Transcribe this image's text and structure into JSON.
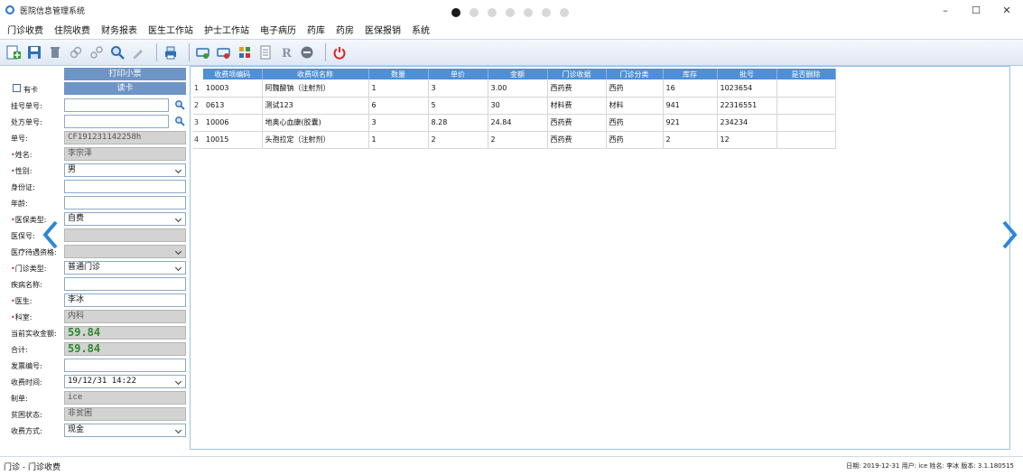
{
  "window": {
    "title": "医院信息管理系统",
    "controls": {
      "minimize": "–",
      "maximize": "☐",
      "close": "✕"
    }
  },
  "menu": [
    "门诊收费",
    "住院收费",
    "财务报表",
    "医生工作站",
    "护士工作站",
    "电子病历",
    "药库",
    "药房",
    "医保报销",
    "系统"
  ],
  "toolbar": {
    "icons": [
      "add-icon",
      "save-icon",
      "delete-icon",
      "link-icon",
      "unlink-icon",
      "search-icon",
      "edit-icon",
      "print-icon",
      "card-in-icon",
      "card-out-icon",
      "grid-icon",
      "document-icon",
      "prescription-icon",
      "stop-icon",
      "power-icon"
    ]
  },
  "left_panel": {
    "print_receipt": "打印小票",
    "has_card": "有卡",
    "read_card": "读卡",
    "fields": {
      "register_no": {
        "label": "挂号单号:",
        "value": ""
      },
      "prescription_no": {
        "label": "处方单号:",
        "value": ""
      },
      "bill_no": {
        "label": "单号:",
        "value": "CF191231142258h"
      },
      "name": {
        "label": "姓名:",
        "value": "李宗泽"
      },
      "gender": {
        "label": "性别:",
        "value": "男"
      },
      "id_card": {
        "label": "身份证:",
        "value": ""
      },
      "age": {
        "label": "年龄:",
        "value": ""
      },
      "insurance_type": {
        "label": "医保类型:",
        "value": "自费"
      },
      "insurance_no": {
        "label": "医保号:",
        "value": ""
      },
      "special_treatment": {
        "label": "医疗待遇资格:",
        "value": ""
      },
      "clinic_type": {
        "label": "门诊类型:",
        "value": "普通门诊"
      },
      "disease_name": {
        "label": "疾病名称:",
        "value": ""
      },
      "doctor": {
        "label": "医生:",
        "value": "李冰"
      },
      "department": {
        "label": "科室:",
        "value": "内科"
      },
      "current_paid": {
        "label": "当前实收金额:",
        "value": "59.84"
      },
      "total": {
        "label": "合计:",
        "value": "59.84"
      },
      "invoice_no": {
        "label": "发票编号:",
        "value": ""
      },
      "charge_time": {
        "label": "收费时间:",
        "value": "19/12/31 14:22"
      },
      "operator": {
        "label": "制单:",
        "value": "ice"
      },
      "poverty_status": {
        "label": "贫困状态:",
        "value": "非贫困"
      },
      "payment_method": {
        "label": "收费方式:",
        "value": "现金"
      }
    }
  },
  "grid": {
    "columns": [
      "收费项编码",
      "收费项名称",
      "数量",
      "单价",
      "金额",
      "门诊收据",
      "门诊分类",
      "库存",
      "批号",
      "是否删除"
    ],
    "rows": [
      [
        "1",
        "10003",
        "阿魏酸钠（注射剂）",
        "1",
        "3",
        "3.00",
        "西药费",
        "西药",
        "16",
        "1023654",
        ""
      ],
      [
        "2",
        "0613",
        "测试123",
        "6",
        "5",
        "30",
        "材料费",
        "材料",
        "941",
        "22316551",
        ""
      ],
      [
        "3",
        "10006",
        "地奥心血康(胶囊)",
        "3",
        "8.28",
        "24.84",
        "西药费",
        "西药",
        "921",
        "234234",
        ""
      ],
      [
        "4",
        "10015",
        "头孢拉定（注射剂）",
        "1",
        "2",
        "2",
        "西药费",
        "西药",
        "2",
        "12",
        ""
      ]
    ]
  },
  "statusbar": {
    "module": "门诊 - 门诊收费",
    "info": "日期: 2019-12-31   用户: ice  姓名: 李冰   版本: 3.1.180515"
  },
  "pager": {
    "count": 7,
    "active": 0
  },
  "colors": {
    "accent": "#4f8fd6",
    "money": "#2d8a2d",
    "required": "#d23030"
  }
}
